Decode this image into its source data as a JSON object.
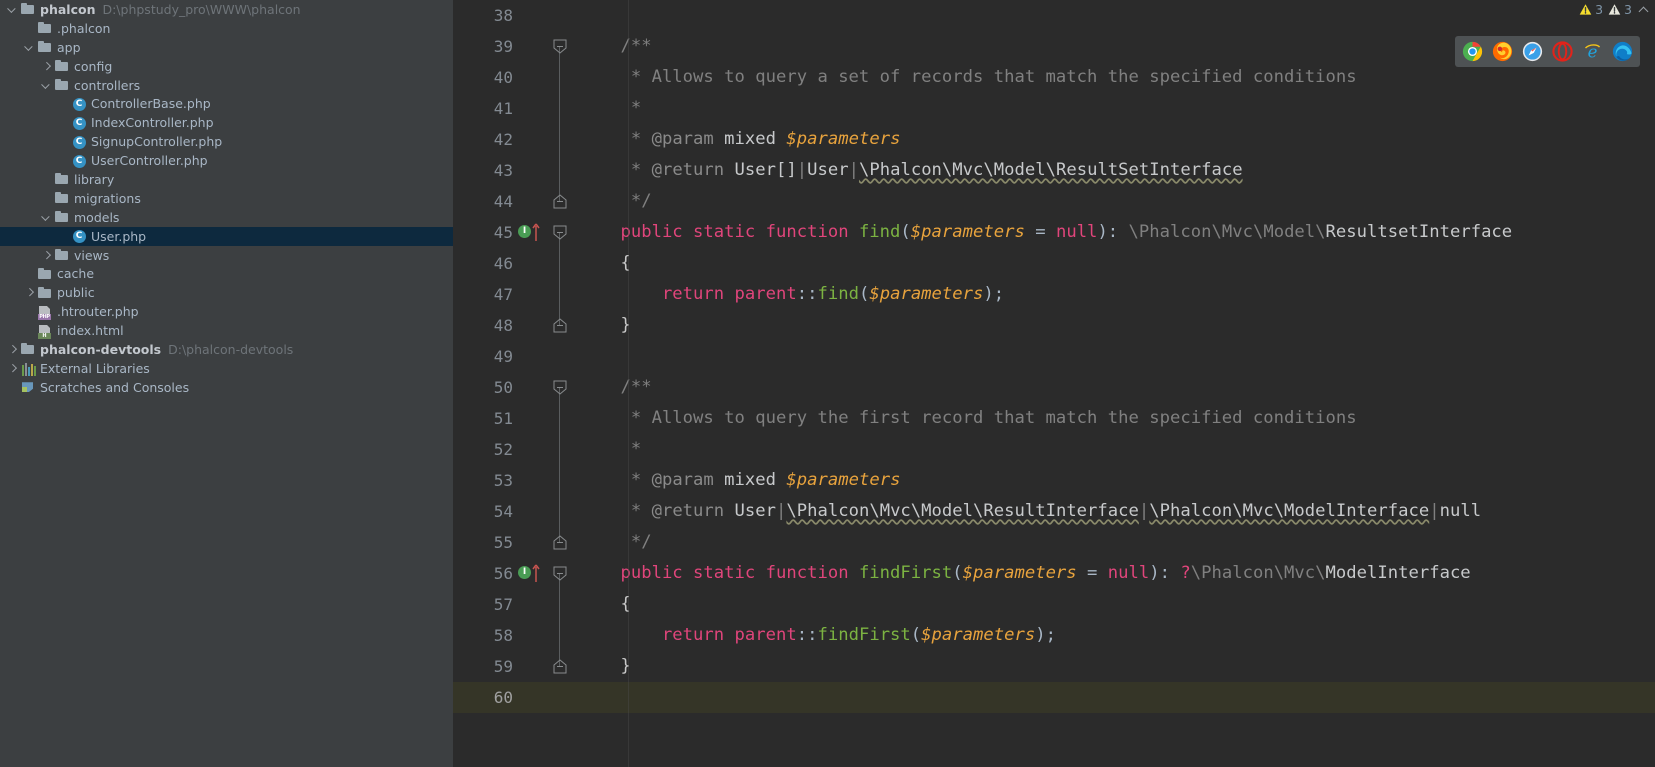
{
  "project_tree": {
    "name": "project-tree",
    "items": [
      {
        "depth": 0,
        "arrow": "down",
        "icon": "folder-icon",
        "label": "phalcon",
        "path": "D:\\phpstudy_pro\\WWW\\phalcon",
        "bold": true,
        "selected": false
      },
      {
        "depth": 1,
        "arrow": "none",
        "icon": "folder-icon",
        "label": ".phalcon",
        "path": "",
        "bold": false,
        "selected": false
      },
      {
        "depth": 1,
        "arrow": "down",
        "icon": "folder-icon",
        "label": "app",
        "path": "",
        "bold": false,
        "selected": false
      },
      {
        "depth": 2,
        "arrow": "right",
        "icon": "folder-icon",
        "label": "config",
        "path": "",
        "bold": false,
        "selected": false
      },
      {
        "depth": 2,
        "arrow": "down",
        "icon": "folder-icon",
        "label": "controllers",
        "path": "",
        "bold": false,
        "selected": false
      },
      {
        "depth": 3,
        "arrow": "none",
        "icon": "php-class-icon",
        "label": "ControllerBase.php",
        "path": "",
        "bold": false,
        "selected": false
      },
      {
        "depth": 3,
        "arrow": "none",
        "icon": "php-class-icon",
        "label": "IndexController.php",
        "path": "",
        "bold": false,
        "selected": false
      },
      {
        "depth": 3,
        "arrow": "none",
        "icon": "php-class-icon",
        "label": "SignupController.php",
        "path": "",
        "bold": false,
        "selected": false
      },
      {
        "depth": 3,
        "arrow": "none",
        "icon": "php-class-icon",
        "label": "UserController.php",
        "path": "",
        "bold": false,
        "selected": false
      },
      {
        "depth": 2,
        "arrow": "none",
        "icon": "folder-icon",
        "label": "library",
        "path": "",
        "bold": false,
        "selected": false
      },
      {
        "depth": 2,
        "arrow": "none",
        "icon": "folder-icon",
        "label": "migrations",
        "path": "",
        "bold": false,
        "selected": false
      },
      {
        "depth": 2,
        "arrow": "down",
        "icon": "folder-icon",
        "label": "models",
        "path": "",
        "bold": false,
        "selected": false
      },
      {
        "depth": 3,
        "arrow": "none",
        "icon": "php-class-icon",
        "label": "User.php",
        "path": "",
        "bold": false,
        "selected": true
      },
      {
        "depth": 2,
        "arrow": "right",
        "icon": "folder-icon",
        "label": "views",
        "path": "",
        "bold": false,
        "selected": false
      },
      {
        "depth": 1,
        "arrow": "none",
        "icon": "folder-icon",
        "label": "cache",
        "path": "",
        "bold": false,
        "selected": false
      },
      {
        "depth": 1,
        "arrow": "right",
        "icon": "folder-icon",
        "label": "public",
        "path": "",
        "bold": false,
        "selected": false
      },
      {
        "depth": 1,
        "arrow": "none",
        "icon": "php-file-icon",
        "label": ".htrouter.php",
        "path": "",
        "bold": false,
        "selected": false
      },
      {
        "depth": 1,
        "arrow": "none",
        "icon": "html-file-icon",
        "label": "index.html",
        "path": "",
        "bold": false,
        "selected": false
      },
      {
        "depth": 0,
        "arrow": "right",
        "icon": "folder-icon",
        "label": "phalcon-devtools",
        "path": "D:\\phalcon-devtools",
        "bold": true,
        "selected": false
      },
      {
        "depth": 0,
        "arrow": "right",
        "icon": "libraries-icon",
        "label": "External Libraries",
        "path": "",
        "bold": false,
        "selected": false
      },
      {
        "depth": 0,
        "arrow": "none",
        "icon": "scratches-icon",
        "label": "Scratches and Consoles",
        "path": "",
        "bold": false,
        "selected": false
      }
    ]
  },
  "editor": {
    "name": "code-editor",
    "file": "User.php",
    "first_line": 38,
    "last_line": 60,
    "current_line": 60,
    "lines": [
      {
        "n": 38,
        "fold": "none",
        "mark": false,
        "html": ""
      },
      {
        "n": 39,
        "fold": "start",
        "mark": false,
        "html": "<span class='t-comment'>    /**</span>"
      },
      {
        "n": 40,
        "fold": "mid",
        "mark": false,
        "html": "<span class='t-comment'>     * Allows to query a set of records that match the specified conditions</span>"
      },
      {
        "n": 41,
        "fold": "mid",
        "mark": false,
        "html": "<span class='t-comment'>     *</span>"
      },
      {
        "n": 42,
        "fold": "mid",
        "mark": false,
        "html": "<span class='t-comment'>     * </span><span class='t-doctag'>@param</span><span class='t-comment'> </span><span class='t-doctype'>mixed</span><span class='t-comment'> </span><span class='t-var'>$parameters</span>"
      },
      {
        "n": 43,
        "fold": "mid",
        "mark": false,
        "html": "<span class='t-comment'>     * </span><span class='t-doctag'>@return</span><span class='t-comment'> </span><span class='t-doctype'>User[]</span><span class='t-comment'>|</span><span class='t-doctype'>User</span><span class='t-comment'>|</span><span class='t-doctype squig'>\\Phalcon\\Mvc\\Model\\ResultSetInterface</span>"
      },
      {
        "n": 44,
        "fold": "end",
        "mark": false,
        "html": "<span class='t-comment'>     */</span>"
      },
      {
        "n": 45,
        "fold": "start",
        "mark": true,
        "html": "<span class='t-kw2'>    public static function </span><span class='t-fn'>find</span><span class='t-punc'>(</span><span class='t-var'>$parameters</span><span class='t-punc'> = </span><span class='t-null'>null</span><span class='t-punc'>): </span><span class='t-ns'>\\Phalcon\\Mvc\\Model\\</span><span class='t-cls'>ResultsetInterface</span>"
      },
      {
        "n": 46,
        "fold": "mid",
        "mark": false,
        "html": "<span class='t-brace'>    {</span>"
      },
      {
        "n": 47,
        "fold": "mid",
        "mark": false,
        "html": "<span class='t-kw2'>        return parent</span><span class='t-punc'>::</span><span class='t-fn'>find</span><span class='t-punc'>(</span><span class='t-var'>$parameters</span><span class='t-punc'>);</span>"
      },
      {
        "n": 48,
        "fold": "end",
        "mark": false,
        "html": "<span class='t-brace'>    }</span>"
      },
      {
        "n": 49,
        "fold": "none",
        "mark": false,
        "html": ""
      },
      {
        "n": 50,
        "fold": "start",
        "mark": false,
        "html": "<span class='t-comment'>    /**</span>"
      },
      {
        "n": 51,
        "fold": "mid",
        "mark": false,
        "html": "<span class='t-comment'>     * Allows to query the first record that match the specified conditions</span>"
      },
      {
        "n": 52,
        "fold": "mid",
        "mark": false,
        "html": "<span class='t-comment'>     *</span>"
      },
      {
        "n": 53,
        "fold": "mid",
        "mark": false,
        "html": "<span class='t-comment'>     * </span><span class='t-doctag'>@param</span><span class='t-comment'> </span><span class='t-doctype'>mixed</span><span class='t-comment'> </span><span class='t-var'>$parameters</span>"
      },
      {
        "n": 54,
        "fold": "mid",
        "mark": false,
        "html": "<span class='t-comment'>     * </span><span class='t-doctag'>@return</span><span class='t-comment'> </span><span class='t-doctype'>User</span><span class='t-comment'>|</span><span class='t-doctype squig'>\\Phalcon\\Mvc\\Model\\ResultInterface</span><span class='t-comment'>|</span><span class='t-doctype squig'>\\Phalcon\\Mvc\\ModelInterface</span><span class='t-comment'>|</span><span class='t-doctype'>null</span>"
      },
      {
        "n": 55,
        "fold": "end",
        "mark": false,
        "html": "<span class='t-comment'>     */</span>"
      },
      {
        "n": 56,
        "fold": "start",
        "mark": true,
        "html": "<span class='t-kw2'>    public static function </span><span class='t-fn'>findFirst</span><span class='t-punc'>(</span><span class='t-var'>$parameters</span><span class='t-punc'> = </span><span class='t-null'>null</span><span class='t-punc'>): </span><span class='t-qm'>?</span><span class='t-ns'>\\Phalcon\\Mvc\\</span><span class='t-cls'>ModelInterface</span>"
      },
      {
        "n": 57,
        "fold": "mid",
        "mark": false,
        "html": "<span class='t-brace'>    {</span>"
      },
      {
        "n": 58,
        "fold": "mid",
        "mark": false,
        "html": "<span class='t-kw2'>        return parent</span><span class='t-punc'>::</span><span class='t-fn'>findFirst</span><span class='t-punc'>(</span><span class='t-var'>$parameters</span><span class='t-punc'>);</span>"
      },
      {
        "n": 59,
        "fold": "end",
        "mark": false,
        "html": "<span class='t-brace'>    }</span>"
      },
      {
        "n": 60,
        "fold": "none",
        "mark": false,
        "html": ""
      }
    ]
  },
  "inspection_widget": {
    "name": "inspection-status",
    "warnings": [
      {
        "icon": "warning-triangle-icon",
        "color": "#f5dd2e",
        "count": "3"
      },
      {
        "icon": "warning-triangle-icon",
        "color": "#e8e8dd",
        "count": "3"
      }
    ],
    "collapse_icon": "chevron-up-icon"
  },
  "browser_bar": {
    "name": "open-in-browser-popup",
    "browsers": [
      {
        "icon": "chrome-icon",
        "label": "Chrome"
      },
      {
        "icon": "firefox-icon",
        "label": "Firefox"
      },
      {
        "icon": "safari-icon",
        "label": "Safari"
      },
      {
        "icon": "opera-icon",
        "label": "Opera"
      },
      {
        "icon": "ie-icon",
        "label": "Internet Explorer"
      },
      {
        "icon": "edge-icon",
        "label": "Edge"
      }
    ]
  },
  "colors": {
    "sidebar_bg": "#3c3f41",
    "editor_bg": "#2b2b2b",
    "selection_bg": "#0d293e",
    "current_line_bg": "#353527",
    "text": "#a9b7c6",
    "line_number": "#606366"
  }
}
